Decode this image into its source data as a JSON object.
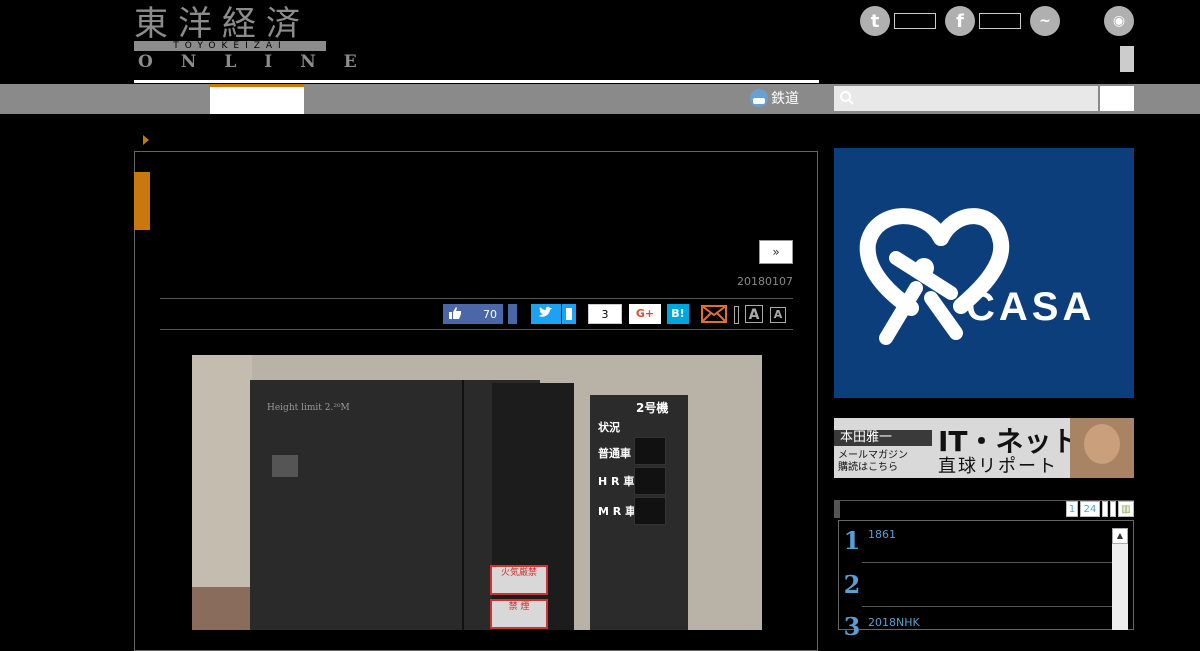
{
  "header": {
    "logo_kanji": "東洋経済",
    "logo_sub": "TOYOKEIZAI",
    "logo_online": "ONLINE",
    "social": [
      {
        "icon": "twitter-icon",
        "glyph": "t"
      },
      {
        "icon": "facebook-icon",
        "glyph": "f"
      },
      {
        "icon": "messenger-icon",
        "glyph": "m"
      },
      {
        "icon": "rss-icon",
        "glyph": "r"
      }
    ]
  },
  "nav": {
    "rail_label": "鉄道",
    "search_placeholder": ""
  },
  "article": {
    "next_label": "»",
    "date": "20180107",
    "like_count": "70",
    "hatena_count": "3",
    "gplus_label": "G+",
    "hatena_label": "B!",
    "font_large": "A",
    "font_small": "A"
  },
  "photo": {
    "door_text": "Height limit 2.²⁰M",
    "stand_title": "2号機",
    "stand_labels": [
      "状況",
      "普通車",
      "H R 車",
      "M R 車"
    ],
    "sign1": "火気厳禁",
    "sign2": "禁 煙"
  },
  "sidebar": {
    "casa_label": "CASA",
    "banner": {
      "name": "本田雅一",
      "mail_line1": "メールマガジン",
      "mail_line2": "購読はこちら",
      "title": "IT・ネット",
      "subtitle": "直球リポート"
    },
    "ranking_tabs": [
      "1",
      "24"
    ],
    "ranking": [
      {
        "num": "1",
        "text": "1861"
      },
      {
        "num": "2",
        "text": ""
      },
      {
        "num": "3",
        "text": "2018NHK"
      }
    ]
  }
}
